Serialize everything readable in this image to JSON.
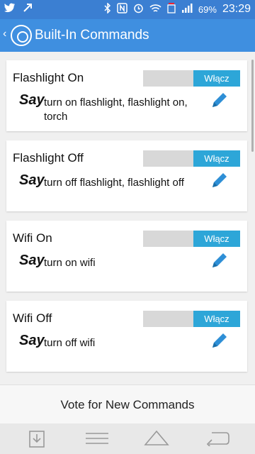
{
  "status_bar": {
    "battery": "69%",
    "time": "23:29"
  },
  "app_bar": {
    "title": "Built-In Commands"
  },
  "commands": [
    {
      "title": "Flashlight On",
      "toggle": "Włącz",
      "say": "Say",
      "phrase": "turn on flashlight, flashlight on, torch"
    },
    {
      "title": "Flashlight Off",
      "toggle": "Włącz",
      "say": "Say",
      "phrase": "turn off flashlight, flashlight off"
    },
    {
      "title": "Wifi On",
      "toggle": "Włącz",
      "say": "Say",
      "phrase": "turn on wifi"
    },
    {
      "title": "Wifi Off",
      "toggle": "Włącz",
      "say": "Say",
      "phrase": "turn off wifi"
    }
  ],
  "vote_label": "Vote for New Commands",
  "icons": {
    "status": [
      "twitter-icon",
      "missed-call-icon",
      "bluetooth-icon",
      "nfc-icon",
      "alarm-icon",
      "wifi-icon",
      "sim-icon",
      "signal-icon"
    ],
    "nav": [
      "download-icon",
      "menu-icon",
      "home-icon",
      "back-icon"
    ]
  }
}
